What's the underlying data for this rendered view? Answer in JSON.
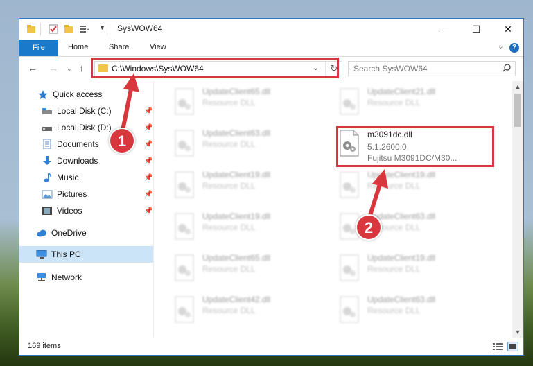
{
  "window": {
    "title": "SysWOW64",
    "controls": {
      "minimize": "—",
      "maximize": "☐",
      "close": "✕"
    }
  },
  "ribbon": {
    "file_tab": "File",
    "tabs": [
      "Home",
      "Share",
      "View"
    ],
    "help": "?"
  },
  "navigation": {
    "address": "C:\\Windows\\SysWOW64",
    "search_placeholder": "Search SysWOW64"
  },
  "sidebar": {
    "quick_access": "Quick access",
    "quick_items": [
      {
        "label": "Local Disk (C:)",
        "icon": "drive-icon"
      },
      {
        "label": "Local Disk (D:)",
        "icon": "drive-icon"
      },
      {
        "label": "Documents",
        "icon": "documents-icon"
      },
      {
        "label": "Downloads",
        "icon": "downloads-icon"
      },
      {
        "label": "Music",
        "icon": "music-icon"
      },
      {
        "label": "Pictures",
        "icon": "pictures-icon"
      },
      {
        "label": "Videos",
        "icon": "videos-icon"
      }
    ],
    "onedrive": "OneDrive",
    "this_pc": "This PC",
    "network": "Network"
  },
  "files": {
    "left_column": [
      {
        "name": "UpdateClient65.dll",
        "type": "Resource DLL"
      },
      {
        "name": "UpdateClient63.dll",
        "type": "Resource DLL"
      },
      {
        "name": "UpdateClient19.dll",
        "type": "Resource DLL"
      },
      {
        "name": "UpdateClient19.dll",
        "type": "Resource DLL"
      },
      {
        "name": "UpdateClient65.dll",
        "type": "Resource DLL"
      },
      {
        "name": "UpdateClient42.dll",
        "type": "Resource DLL"
      }
    ],
    "right_column": [
      {
        "name": "UpdateClient21.dll",
        "type": "Resource DLL"
      },
      {
        "name": "m3091dc.dll",
        "version": "5.1.2600.0",
        "description": "Fujitsu M3091DC/M30..."
      },
      {
        "name": "UpdateClient19.dll",
        "type": "Resource DLL"
      },
      {
        "name": "UpdateClient63.dll",
        "type": "Resource DLL"
      },
      {
        "name": "UpdateClient19.dll",
        "type": "Resource DLL"
      },
      {
        "name": "UpdateClient63.dll",
        "type": "Resource DLL"
      }
    ]
  },
  "status": {
    "item_count": "169 items"
  },
  "annotations": {
    "step1": "1",
    "step2": "2",
    "color": "#d9373e"
  }
}
